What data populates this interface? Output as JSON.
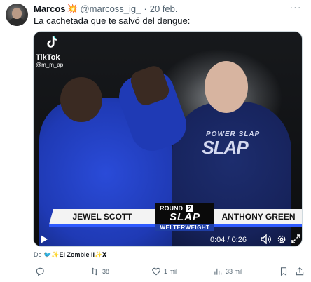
{
  "tweet": {
    "author_name": "Marcos",
    "author_decoration": "💥",
    "handle": "@marcoss_ig_",
    "separator": "·",
    "date": "20 feb.",
    "text": "La cachetada que te salvó del dengue:"
  },
  "video": {
    "watermark_brand": "TikTok",
    "watermark_user": "@m_m_ap",
    "shirt_brand": "POWER SLAP",
    "lower_third": {
      "fighter_left": "JEWEL SCOTT",
      "fighter_right": "ANTHONY GREEN",
      "round_label": "ROUND",
      "round_number": "2",
      "logo": "SLAP",
      "division": "WELTERWEIGHT"
    },
    "time_display": "0:04 / 0:26",
    "icons": {
      "play": "play-icon",
      "volume": "volume-icon",
      "settings": "settings-icon",
      "fullscreen": "fullscreen-icon"
    }
  },
  "attribution": {
    "prefix": "De",
    "source": "🐦✨El Zombie II✨𝐗"
  },
  "actions": {
    "replies": "",
    "retweets": "38",
    "likes": "1 mil",
    "views": "33 mil"
  },
  "colors": {
    "text_secondary": "#536471",
    "brand_blue": "#2f5bff",
    "decoration": "#e0245e"
  }
}
